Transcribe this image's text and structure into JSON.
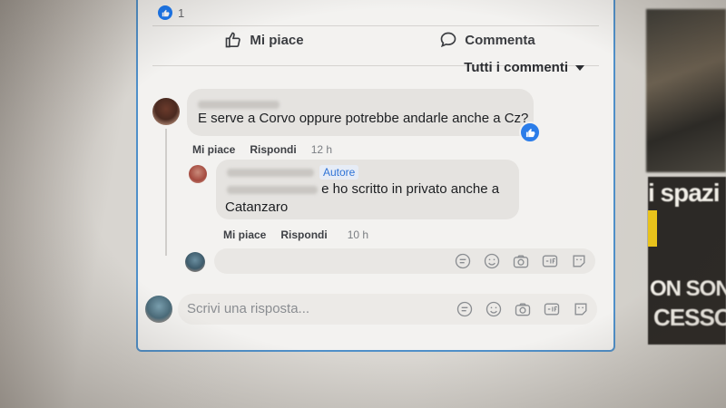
{
  "post": {
    "reaction_count": "1"
  },
  "actions": {
    "like_label": "Mi piace",
    "comment_label": "Commenta"
  },
  "sort": {
    "label": "Tutti i commenti"
  },
  "comments": [
    {
      "text": "E serve a Corvo oppure potrebbe andarle anche a Cz?",
      "like_label": "Mi piace",
      "reply_label": "Rispondi",
      "time": "12 h"
    }
  ],
  "reply": {
    "author_badge": "Autore",
    "text_line1": "e ho scritto in privato anche a",
    "text_line2": "Catanzaro",
    "like_label": "Mi piace",
    "reply_label": "Rispondi",
    "time": "10 h"
  },
  "composer": {
    "placeholder": "Scrivi una risposta..."
  },
  "side": {
    "headline1": "i spazi",
    "headline2": "ON SON",
    "headline3": "CESSO"
  },
  "colors": {
    "accent": "#1877f2",
    "card_border": "#4f8fc8",
    "author_badge": "#2f73d6"
  }
}
